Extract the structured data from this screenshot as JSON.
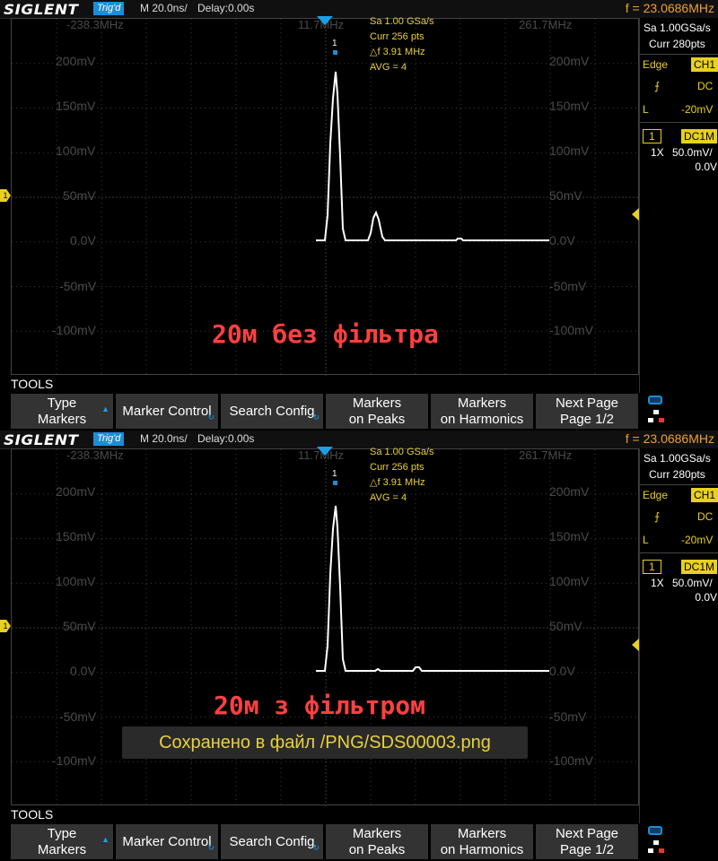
{
  "screens": [
    {
      "top_bar": {
        "brand": "SIGLENT",
        "trig_status": "Trig'd",
        "timebase": "M 20.0ns/",
        "delay": "Delay:0.00s",
        "freq": "f = 23.0686MHz"
      },
      "x_header": {
        "left": "-238.3MHz",
        "center": "11.7MHz",
        "right": "261.7MHz"
      },
      "y_labels": [
        "200mV",
        "150mV",
        "100mV",
        "50mV",
        "0.0V",
        "-50mV",
        "-100mV"
      ],
      "y_labels_right": [
        "200mV",
        "150mV",
        "100mV",
        "50mV",
        "0.0V",
        "-50mV",
        "-100mV"
      ],
      "fft_info": [
        "Sa 1.00 GSa/s",
        "Curr 256 pts",
        "△f 3.91 MHz",
        "AVG = 4"
      ],
      "marker_label": "1",
      "caption": "20м без фільтра",
      "right_panel": {
        "sa": "Sa 1.00GSa/s",
        "curr": "Curr 280pts",
        "trig_type": "Edge",
        "trig_src": "CH1",
        "coupling": "DC",
        "level_label": "L",
        "level_value": "-20mV",
        "ch_num": "1",
        "ch_coupling": "DC1M",
        "probe": "1X",
        "vdiv": "50.0mV/",
        "offset": "0.0V"
      },
      "tools_label": "TOOLS",
      "menu": [
        {
          "l1": "Type",
          "l2": "Markers"
        },
        {
          "l1": "Marker Control",
          "l2": ""
        },
        {
          "l1": "Search Config",
          "l2": ""
        },
        {
          "l1": "Markers",
          "l2": "on Peaks"
        },
        {
          "l1": "Markers",
          "l2": "on Harmonics"
        },
        {
          "l1": "Next Page",
          "l2": "Page 1/2"
        }
      ],
      "trace": [
        [
          352,
          268
        ],
        [
          362,
          268
        ],
        [
          365,
          240
        ],
        [
          368,
          160
        ],
        [
          371,
          110
        ],
        [
          374,
          80
        ],
        [
          376,
          105
        ],
        [
          379,
          175
        ],
        [
          382,
          255
        ],
        [
          385,
          268
        ],
        [
          410,
          268
        ],
        [
          413,
          260
        ],
        [
          416,
          243
        ],
        [
          419,
          237
        ],
        [
          422,
          245
        ],
        [
          426,
          264
        ],
        [
          429,
          268
        ],
        [
          508,
          268
        ],
        [
          510,
          266
        ],
        [
          514,
          266
        ],
        [
          516,
          268
        ],
        [
          612,
          268
        ]
      ]
    },
    {
      "top_bar": {
        "brand": "SIGLENT",
        "trig_status": "Trig'd",
        "timebase": "M 20.0ns/",
        "delay": "Delay:0.00s",
        "freq": "f = 23.0686MHz"
      },
      "x_header": {
        "left": "-238.3MHz",
        "center": "11.7MHz",
        "right": "261.7MHz"
      },
      "y_labels": [
        "200mV",
        "150mV",
        "100mV",
        "50mV",
        "0.0V",
        "-50mV",
        "-100mV"
      ],
      "y_labels_right": [
        "200mV",
        "150mV",
        "100mV",
        "50mV",
        "0.0V",
        "-50mV",
        "-100mV"
      ],
      "fft_info": [
        "Sa 1.00 GSa/s",
        "Curr 256 pts",
        "△f 3.91 MHz",
        "AVG = 4"
      ],
      "marker_label": "1",
      "caption": "20м з фільтром",
      "right_panel": {
        "sa": "Sa 1.00GSa/s",
        "curr": "Curr 280pts",
        "trig_type": "Edge",
        "trig_src": "CH1",
        "coupling": "DC",
        "level_label": "L",
        "level_value": "-20mV",
        "ch_num": "1",
        "ch_coupling": "DC1M",
        "probe": "1X",
        "vdiv": "50.0mV/",
        "offset": "0.0V"
      },
      "tools_label": "TOOLS",
      "menu": [
        {
          "l1": "Type",
          "l2": "Markers"
        },
        {
          "l1": "Marker Control",
          "l2": ""
        },
        {
          "l1": "Search Config",
          "l2": ""
        },
        {
          "l1": "Markers",
          "l2": "on Peaks"
        },
        {
          "l1": "Markers",
          "l2": "on Harmonics"
        },
        {
          "l1": "Next Page",
          "l2": "Page 1/2"
        }
      ],
      "trace": [
        [
          352,
          268
        ],
        [
          362,
          268
        ],
        [
          365,
          240
        ],
        [
          368,
          160
        ],
        [
          371,
          110
        ],
        [
          374,
          84
        ],
        [
          376,
          108
        ],
        [
          379,
          175
        ],
        [
          382,
          255
        ],
        [
          385,
          268
        ],
        [
          418,
          268
        ],
        [
          421,
          266
        ],
        [
          424,
          268
        ],
        [
          460,
          268
        ],
        [
          463,
          264
        ],
        [
          467,
          264
        ],
        [
          470,
          268
        ],
        [
          612,
          268
        ]
      ]
    }
  ],
  "toast": "Сохранено в файл /PNG/SDS00003.png"
}
